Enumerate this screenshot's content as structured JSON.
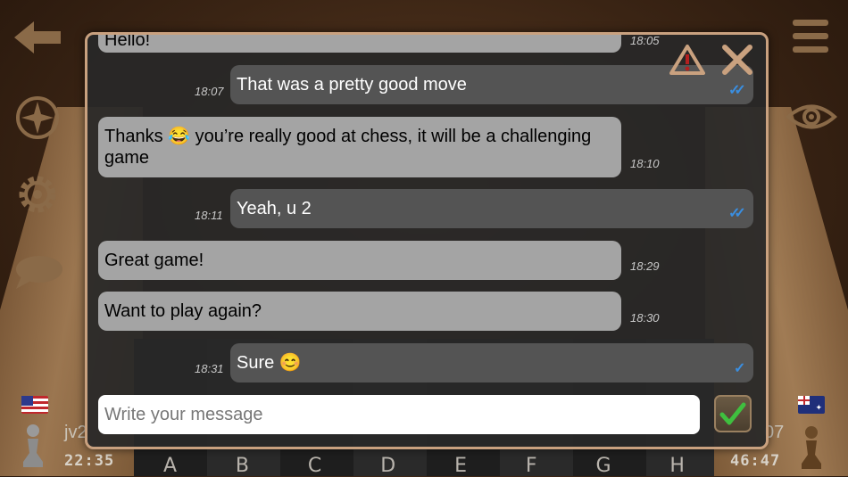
{
  "board": {
    "files": [
      "A",
      "B",
      "C",
      "D",
      "E",
      "F",
      "G",
      "H"
    ]
  },
  "players": {
    "left": {
      "name": "jv2",
      "clock": "22:35",
      "flag": "US"
    },
    "right": {
      "name": "07",
      "clock": "46:47",
      "flag": "AU"
    }
  },
  "icons": {
    "back": "arrow-left-icon",
    "compass": "compass-icon",
    "settings": "gear-icon",
    "chat": "chat-bubble-icon",
    "menu": "hamburger-menu-icon",
    "eye": "eye-icon",
    "warning": "warning-icon",
    "close": "close-icon",
    "send": "checkmark-icon"
  },
  "chat": {
    "messages": [
      {
        "dir": "in",
        "text": "Hello!",
        "time": "18:05"
      },
      {
        "dir": "out",
        "text": "That was a pretty good move",
        "time": "18:07",
        "read": true
      },
      {
        "dir": "in",
        "text": "Thanks 😂 you’re really good at chess, it will be a challenging game",
        "time": "18:10"
      },
      {
        "dir": "out",
        "text": "Yeah, u 2",
        "time": "18:11",
        "read": true
      },
      {
        "dir": "in",
        "text": "Great game!",
        "time": "18:29"
      },
      {
        "dir": "in",
        "text": "Want to play again?",
        "time": "18:30"
      },
      {
        "dir": "out",
        "text": "Sure 😊",
        "time": "18:31",
        "read": true
      }
    ],
    "input_placeholder": "Write your message"
  },
  "colors": {
    "read_tick": "#3a8ee0",
    "send_check": "#3fbf3f",
    "panel_border": "#c9a17f"
  }
}
